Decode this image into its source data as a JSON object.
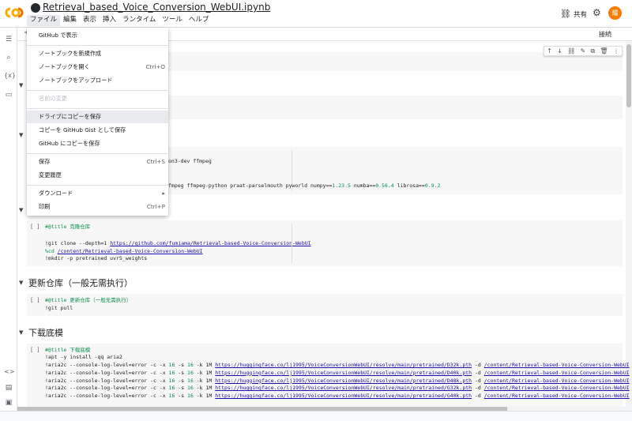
{
  "app": {
    "title": "Retrieval_based_Voice_Conversion_WebUI.ipynb",
    "share_label": "共有",
    "avatar_letter": "耀"
  },
  "menubar": [
    "ファイル",
    "編集",
    "表示",
    "挿入",
    "ランタイム",
    "ツール",
    "ヘルプ"
  ],
  "toolbar": {
    "connect_label": "接続"
  },
  "file_menu": {
    "items": [
      {
        "label": "GitHub で表示",
        "shortcut": ""
      },
      {
        "label": "ノートブックを新規作成",
        "shortcut": ""
      },
      {
        "label": "ノートブックを開く",
        "shortcut": "Ctrl+O"
      },
      {
        "label": "ノートブックをアップロード",
        "shortcut": ""
      },
      {
        "label": "名前の変更",
        "shortcut": ""
      },
      {
        "label": "ドライブにコピーを保存",
        "shortcut": ""
      },
      {
        "label": "コピーを GitHub Gist として保存",
        "shortcut": ""
      },
      {
        "label": "GitHub にコピーを保存",
        "shortcut": ""
      },
      {
        "label": "保存",
        "shortcut": "Ctrl+S"
      },
      {
        "label": "変更履歴",
        "shortcut": ""
      },
      {
        "label": "ダウンロード",
        "shortcut": "▸"
      },
      {
        "label": "印刷",
        "shortcut": "Ctrl+P"
      }
    ]
  },
  "icons": {
    "github": "github-icon",
    "link": "link-icon",
    "gear": "gear-icon"
  },
  "cells": {
    "partial1": "on3-dev ffmpeg",
    "partial2_a": "fmpeg ffmpeg-python praat-parselmouth pyworld numpy==",
    "partial2_b": "1.23.5",
    "partial2_c": " numba==",
    "partial2_d": "0.56.4",
    "partial2_e": " librosa==",
    "partial2_f": "0.9.2",
    "clone": {
      "bracket": "[ ]",
      "title": "#@title 克隆仓库",
      "line1_a": "!git clone --depth=1 ",
      "line1_url": "https://github.com/fumiama/Retrieval-based-Voice-Conversion-WebUI",
      "line2_a": "%cd ",
      "line2_url": "/content/Retrieval-based-Voice-Conversion-WebUI",
      "line3": "!mkdir -p pretrained uvr5_weights"
    },
    "update_heading": "更新仓库（一般无需执行）",
    "update": {
      "bracket": "[ ]",
      "title": "#@title 更新仓库（一般无需执行）",
      "line1": "!git pull"
    },
    "download_heading": "下载底模",
    "download": {
      "bracket": "[ ]",
      "title": "#@title 下载底模",
      "line1": "!apt -y install -qq aria2",
      "lines": [
        {
          "url": "https://huggingface.co/lj1995/VoiceConversionWebUI/resolve/main/pretrained/D32k.pth",
          "dest": "/content/Retrieval-based-Voice-Conversion-WebUI"
        },
        {
          "url": "https://huggingface.co/lj1995/VoiceConversionWebUI/resolve/main/pretrained/D40k.pth",
          "dest": "/content/Retrieval-based-Voice-Conversion-WebUI"
        },
        {
          "url": "https://huggingface.co/lj1995/VoiceConversionWebUI/resolve/main/pretrained/D48k.pth",
          "dest": "/content/Retrieval-based-Voice-Conversion-WebUI"
        },
        {
          "url": "https://huggingface.co/lj1995/VoiceConversionWebUI/resolve/main/pretrained/G32k.pth",
          "dest": "/content/Retrieval-based-Voice-Conversion-WebUI"
        },
        {
          "url": "https://huggingface.co/lj1995/VoiceConversionWebUI/resolve/main/pretrained/G40k.pth",
          "dest": "/content/Retrieval-based-Voice-Conversion-WebUI"
        }
      ],
      "aria_prefix": "!aria2c --console-log-level=error -c -x ",
      "n16": "16",
      "s_flag": " -s ",
      "k_flag": " -k ",
      "m1": "1M ",
      "d_flag": " -d "
    }
  }
}
